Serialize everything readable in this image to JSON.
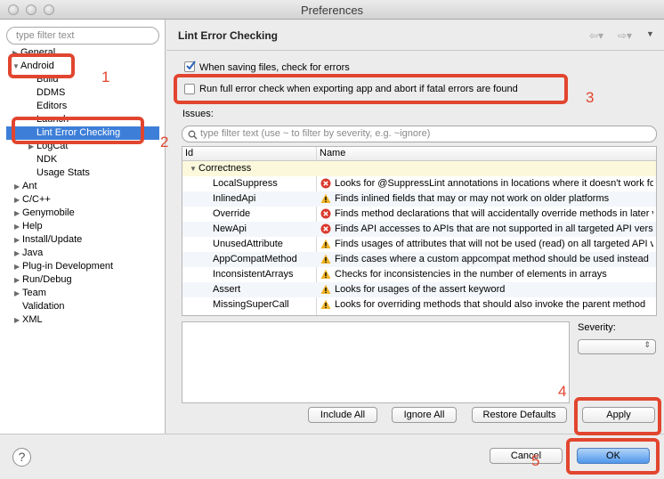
{
  "window": {
    "title": "Preferences"
  },
  "left": {
    "filter_placeholder": "type filter text",
    "tree": [
      {
        "label": "General"
      },
      {
        "label": "Android"
      },
      {
        "label": "Build"
      },
      {
        "label": "DDMS"
      },
      {
        "label": "Editors"
      },
      {
        "label": "Launch"
      },
      {
        "label": "Lint Error Checking"
      },
      {
        "label": "LogCat"
      },
      {
        "label": "NDK"
      },
      {
        "label": "Usage Stats"
      },
      {
        "label": "Ant"
      },
      {
        "label": "C/C++"
      },
      {
        "label": "Genymobile"
      },
      {
        "label": "Help"
      },
      {
        "label": "Install/Update"
      },
      {
        "label": "Java"
      },
      {
        "label": "Plug-in Development"
      },
      {
        "label": "Run/Debug"
      },
      {
        "label": "Team"
      },
      {
        "label": "Validation"
      },
      {
        "label": "XML"
      }
    ]
  },
  "page": {
    "title": "Lint Error Checking",
    "check_on_save": "When saving files, check for errors",
    "full_check": "Run full error check when exporting app and abort if fatal errors are found",
    "issues_label": "Issues:",
    "issues_filter_placeholder": "type filter text (use ~ to filter by severity, e.g. ~ignore)",
    "col_id": "Id",
    "col_name": "Name",
    "category": "Correctness",
    "rows": [
      {
        "id": "LocalSuppress",
        "sev": "error",
        "name": "Looks for @SuppressLint annotations in locations where it doesn't work for class based checks"
      },
      {
        "id": "InlinedApi",
        "sev": "warning",
        "name": "Finds inlined fields that may or may not work on older platforms"
      },
      {
        "id": "Override",
        "sev": "error",
        "name": "Finds method declarations that will accidentally override methods in later versions"
      },
      {
        "id": "NewApi",
        "sev": "error",
        "name": "Finds API accesses to APIs that are not supported in all targeted API versions"
      },
      {
        "id": "UnusedAttribute",
        "sev": "warning",
        "name": "Finds usages of attributes that will not be used (read) on all targeted API versions"
      },
      {
        "id": "AppCompatMethod",
        "sev": "warning",
        "name": "Finds cases where a custom appcompat method should be used instead"
      },
      {
        "id": "InconsistentArrays",
        "sev": "warning",
        "name": "Checks for inconsistencies in the number of elements in arrays"
      },
      {
        "id": "Assert",
        "sev": "warning",
        "name": "Looks for usages of the assert keyword"
      },
      {
        "id": "MissingSuperCall",
        "sev": "warning",
        "name": "Looks for overriding methods that should also invoke the parent method"
      }
    ],
    "severity_label": "Severity:",
    "include_all": "Include All",
    "ignore_all": "Ignore All",
    "restore_defaults": "Restore Defaults",
    "apply": "Apply"
  },
  "bottom": {
    "help": "?",
    "cancel": "Cancel",
    "ok": "OK"
  },
  "annotations": [
    "1",
    "2",
    "3",
    "4",
    "5"
  ],
  "colors": {
    "selection": "#3d7fd8",
    "annotation": "#e2452f",
    "default_button": "#4f97ec"
  }
}
